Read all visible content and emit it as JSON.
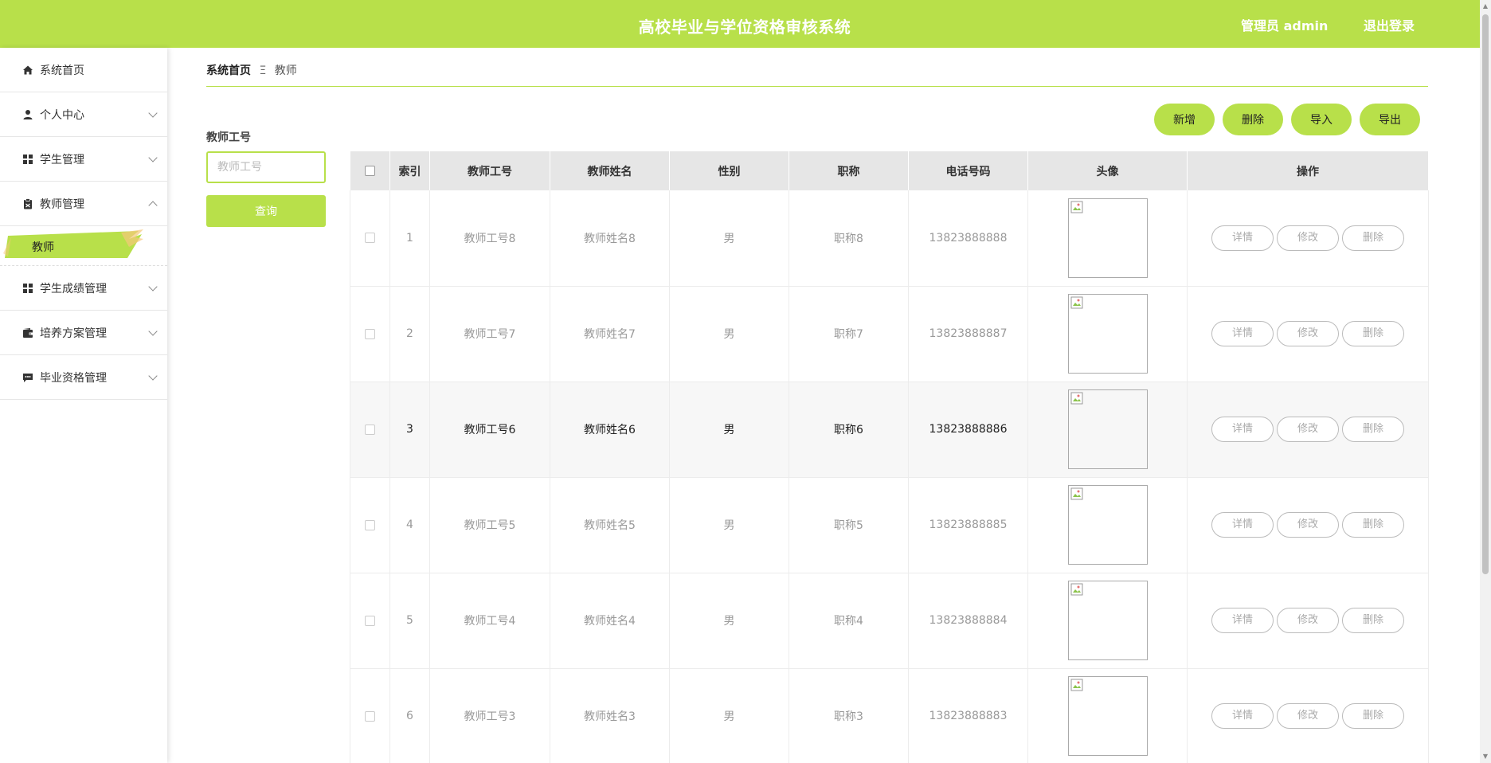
{
  "header": {
    "title": "高校毕业与学位资格审核系统",
    "admin": "管理员 admin",
    "logout": "退出登录"
  },
  "sidebar": {
    "items": [
      {
        "label": "系统首页",
        "icon": "home-icon",
        "expandable": false
      },
      {
        "label": "个人中心",
        "icon": "user-icon",
        "expandable": true
      },
      {
        "label": "学生管理",
        "icon": "grid-icon",
        "expandable": true
      },
      {
        "label": "教师管理",
        "icon": "clipboard-icon",
        "expandable": true,
        "expanded": true
      },
      {
        "label": "学生成绩管理",
        "icon": "grid-icon",
        "expandable": true
      },
      {
        "label": "培养方案管理",
        "icon": "wallet-icon",
        "expandable": true
      },
      {
        "label": "毕业资格管理",
        "icon": "chat-icon",
        "expandable": true
      }
    ],
    "active_sub": "教师"
  },
  "breadcrumb": {
    "home": "系统首页",
    "sep": "Ξ",
    "current": "教师"
  },
  "search": {
    "label": "教师工号",
    "placeholder": "教师工号",
    "button": "查询"
  },
  "actions": {
    "add": "新增",
    "delete": "删除",
    "import": "导入",
    "export": "导出"
  },
  "table": {
    "columns": [
      "索引",
      "教师工号",
      "教师姓名",
      "性别",
      "职称",
      "电话号码",
      "头像",
      "操作"
    ],
    "rows": [
      {
        "index": "1",
        "id": "教师工号8",
        "name": "教师姓名8",
        "gender": "男",
        "title": "职称8",
        "phone": "13823888888"
      },
      {
        "index": "2",
        "id": "教师工号7",
        "name": "教师姓名7",
        "gender": "男",
        "title": "职称7",
        "phone": "13823888887"
      },
      {
        "index": "3",
        "id": "教师工号6",
        "name": "教师姓名6",
        "gender": "男",
        "title": "职称6",
        "phone": "13823888886"
      },
      {
        "index": "4",
        "id": "教师工号5",
        "name": "教师姓名5",
        "gender": "男",
        "title": "职称5",
        "phone": "13823888885"
      },
      {
        "index": "5",
        "id": "教师工号4",
        "name": "教师姓名4",
        "gender": "男",
        "title": "职称4",
        "phone": "13823888884"
      },
      {
        "index": "6",
        "id": "教师工号3",
        "name": "教师姓名3",
        "gender": "男",
        "title": "职称3",
        "phone": "13823888883"
      }
    ],
    "row_buttons": {
      "detail": "详情",
      "edit": "修改",
      "delete": "删除"
    }
  },
  "colors": {
    "accent": "#b8e04a",
    "header_bg": "#b8e04a",
    "table_header_bg": "#e6e6e6"
  }
}
